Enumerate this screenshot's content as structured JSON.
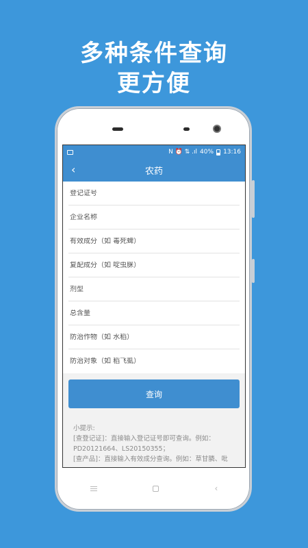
{
  "promo": {
    "line1": "多种条件查询",
    "line2": "更方便"
  },
  "status_bar": {
    "battery": "40%",
    "time": "13:16",
    "indicators": "N ⏰ ⇅ .ıl"
  },
  "app_bar": {
    "back_icon": "‹",
    "title": "农药"
  },
  "form": {
    "fields": [
      {
        "placeholder": "登记证号",
        "value": ""
      },
      {
        "placeholder": "企业名称",
        "value": ""
      },
      {
        "placeholder": "有效成分（如 毒死蜱）",
        "value": ""
      },
      {
        "placeholder": "复配成分（如 啶虫脒）",
        "value": ""
      },
      {
        "placeholder": "剂型",
        "value": ""
      },
      {
        "placeholder": "总含量",
        "value": ""
      },
      {
        "placeholder": "防治作物（如 水稻）",
        "value": ""
      },
      {
        "placeholder": "防治对象（如 稻飞虱）",
        "value": ""
      }
    ],
    "submit_label": "查询"
  },
  "tips": {
    "title": "小提示:",
    "line1": "[查登记证]：直接输入登记证号即可查询。例如：",
    "line2": "PD20121664、LS20150355；",
    "line3": "[查产品]：直接输入有效成分查询。例如：草甘膦、吡"
  },
  "nav": {
    "back_glyph": "‹"
  }
}
